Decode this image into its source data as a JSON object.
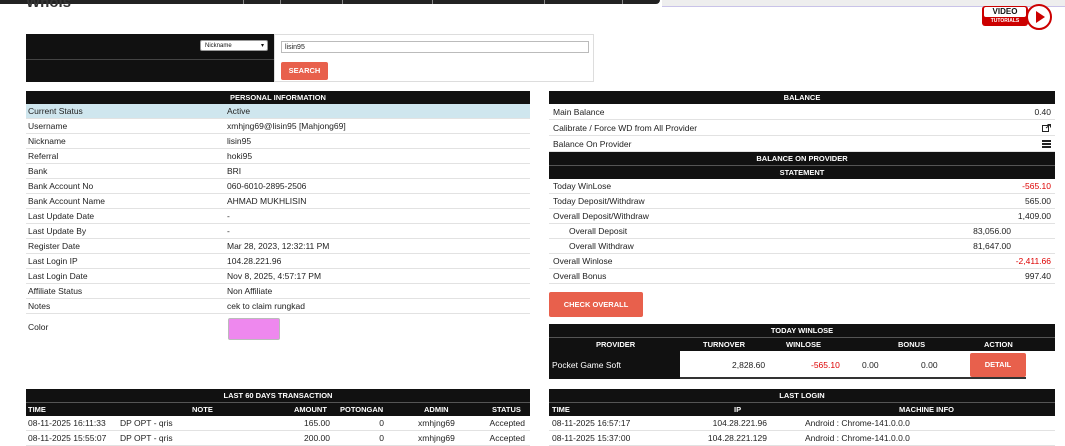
{
  "page": {
    "title": "Whois"
  },
  "video_badge": {
    "line1": "VIDEO",
    "line2": "TUTORIALS"
  },
  "search": {
    "select_value": "Nickname",
    "input_value": "lisin95",
    "button_label": "SEARCH"
  },
  "personal": {
    "title": "PERSONAL INFORMATION",
    "rows": [
      {
        "label": "Current Status",
        "value": "Active"
      },
      {
        "label": "Username",
        "value": "xmhjng69@lisin95  [Mahjong69]"
      },
      {
        "label": "Nickname",
        "value": "lisin95"
      },
      {
        "label": "Referral",
        "value": "hoki95"
      },
      {
        "label": "Bank",
        "value": "BRI"
      },
      {
        "label": "Bank Account No",
        "value": "060-6010-2895-2506"
      },
      {
        "label": "Bank Account Name",
        "value": "AHMAD MUKHLISIN"
      },
      {
        "label": "Last Update Date",
        "value": "-"
      },
      {
        "label": "Last Update By",
        "value": "-"
      },
      {
        "label": "Register Date",
        "value": "Mar 28, 2023, 12:32:11 PM"
      },
      {
        "label": "Last Login IP",
        "value": "104.28.221.96"
      },
      {
        "label": "Last Login Date",
        "value": "Nov 8, 2025, 4:57:17 PM"
      },
      {
        "label": "Affiliate Status",
        "value": "Non Affiliate"
      },
      {
        "label": "Notes",
        "value": "cek to claim rungkad"
      }
    ],
    "color_label": "Color",
    "color_value": "#ee88ee"
  },
  "balance": {
    "title": "BALANCE",
    "main_label": "Main Balance",
    "main_value": "0.40",
    "calibrate_label": "Calibrate / Force WD from All Provider",
    "on_provider_label": "Balance On Provider",
    "provider_title": "BALANCE ON PROVIDER",
    "statement_title": "STATEMENT",
    "statement": [
      {
        "label": "Today WinLose",
        "value": "-565.10",
        "neg": true,
        "sub": false
      },
      {
        "label": "Today Deposit/Withdraw",
        "value": "565.00",
        "neg": false,
        "sub": false
      },
      {
        "label": "Overall Deposit/Withdraw",
        "value": "1,409.00",
        "neg": false,
        "sub": false
      },
      {
        "label": "Overall Deposit",
        "value": "83,056.00",
        "neg": false,
        "sub": true
      },
      {
        "label": "Overall Withdraw",
        "value": "81,647.00",
        "neg": false,
        "sub": true
      },
      {
        "label": "Overall Winlose",
        "value": "-2,411.66",
        "neg": true,
        "sub": false
      },
      {
        "label": "Overall Bonus",
        "value": "997.40",
        "neg": false,
        "sub": false
      }
    ],
    "check_overall_label": "CHECK OVERALL"
  },
  "winlose": {
    "title": "TODAY WINLOSE",
    "headers": [
      "PROVIDER",
      "TURNOVER",
      "WINLOSE",
      "BONUS",
      "ACTION"
    ],
    "row": {
      "provider": "Pocket Game Soft",
      "turnover": "2,828.60",
      "winlose": "-565.10",
      "bonus1": "0.00",
      "bonus2": "0.00",
      "action": "DETAIL"
    }
  },
  "transactions": {
    "title": "LAST 60 DAYS TRANSACTION",
    "headers": [
      "TIME",
      "NOTE",
      "AMOUNT",
      "POTONGAN",
      "ADMIN",
      "STATUS"
    ],
    "rows": [
      {
        "time": "08-11-2025 16:11:33",
        "note": "DP OPT - qris",
        "amount": "165.00",
        "potongan": "0",
        "admin": "xmhjng69",
        "status": "Accepted"
      },
      {
        "time": "08-11-2025 15:55:07",
        "note": "DP OPT - qris",
        "amount": "200.00",
        "potongan": "0",
        "admin": "xmhjng69",
        "status": "Accepted"
      }
    ]
  },
  "last_login": {
    "title": "LAST LOGIN",
    "headers": [
      "TIME",
      "IP",
      "MACHINE INFO"
    ],
    "rows": [
      {
        "time": "08-11-2025 16:57:17",
        "ip": "104.28.221.96",
        "machine": "Android : Chrome-141.0.0.0"
      },
      {
        "time": "08-11-2025 15:37:00",
        "ip": "104.28.221.129",
        "machine": "Android : Chrome-141.0.0.0"
      }
    ]
  }
}
